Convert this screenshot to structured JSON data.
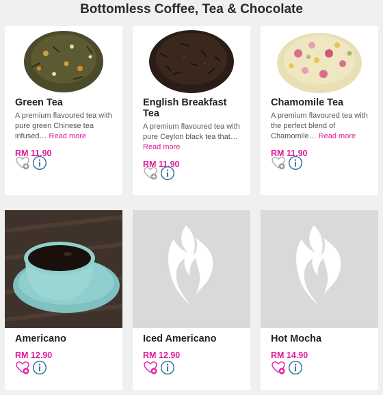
{
  "section": {
    "title": "Bottomless Coffee, Tea & Chocolate"
  },
  "colors": {
    "accent": "#e0199a",
    "info": "#2a6f9c",
    "placeholder_bg": "#d9d9d9"
  },
  "products": [
    {
      "name": "Green Tea",
      "desc": "A premium flavoured tea with pure green Chinese tea infused…",
      "more": "Read more",
      "price": "RM 11.90",
      "image": "green-tea-leaves"
    },
    {
      "name": "English Breakfast Tea",
      "desc": "A premium flavoured tea with pure Ceylon black tea that…",
      "more": "Read more",
      "price": "RM 11.90",
      "image": "black-tea-leaves"
    },
    {
      "name": "Chamomile Tea",
      "desc": "A premium flavoured tea with the perfect blend of Chamomile…",
      "more": "Read more",
      "price": "RM 11.90",
      "image": "chamomile-tea-blend"
    },
    {
      "name": "Americano",
      "price": "RM 12.90",
      "image": "coffee-cup-photo"
    },
    {
      "name": "Iced Americano",
      "price": "RM 12.90",
      "image": "placeholder-flame-icon"
    },
    {
      "name": "Hot Mocha",
      "price": "RM 14.90",
      "image": "placeholder-flame-icon"
    }
  ]
}
